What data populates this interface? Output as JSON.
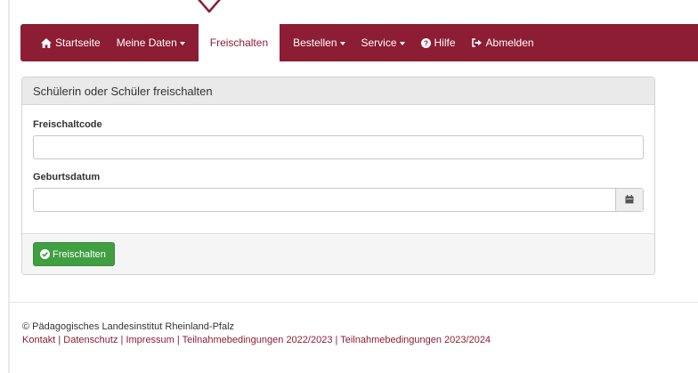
{
  "colors": {
    "brand": "#8c1d34",
    "success": "#3f9f41",
    "panel_header": "#eaeaea"
  },
  "nav": {
    "items": [
      {
        "label": "Startseite",
        "icon": "home-icon",
        "dropdown": false,
        "active": false
      },
      {
        "label": "Meine Daten",
        "icon": "",
        "dropdown": true,
        "active": false
      },
      {
        "label": "Freischalten",
        "icon": "",
        "dropdown": false,
        "active": true
      },
      {
        "label": "Bestellen",
        "icon": "",
        "dropdown": true,
        "active": false
      },
      {
        "label": "Service",
        "icon": "",
        "dropdown": true,
        "active": false
      },
      {
        "label": "Hilfe",
        "icon": "question-circle-icon",
        "dropdown": false,
        "active": false
      },
      {
        "label": "Abmelden",
        "icon": "sign-out-icon",
        "dropdown": false,
        "active": false
      }
    ]
  },
  "panel": {
    "title": "Schülerin oder Schüler freischalten",
    "fields": {
      "code_label": "Freischaltcode",
      "code_value": "",
      "birth_label": "Geburtsdatum",
      "birth_value": ""
    },
    "submit_label": "Freischalten",
    "submit_icon": "check-circle-icon",
    "calendar_icon": "calendar-icon"
  },
  "footer": {
    "copyright": "© Pädagogisches Landesinstitut Rheinland-Pfalz",
    "links": [
      "Kontakt",
      "Datenschutz",
      "Impressum",
      "Teilnahmebedingungen 2022/2023",
      "Teilnahmebedingungen 2023/2024"
    ],
    "separator": "|"
  }
}
